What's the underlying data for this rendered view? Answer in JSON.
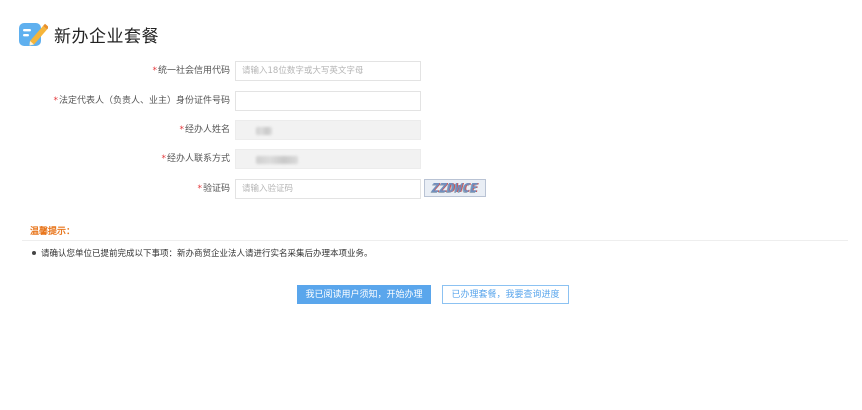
{
  "page": {
    "title": "新办企业套餐",
    "icon": "edit-document-icon",
    "accent_color": "#5aa6ec"
  },
  "form": {
    "required_mark": "*",
    "fields": [
      {
        "label": "统一社会信用代码",
        "placeholder": "请输入18位数字或大写英文字母",
        "value": ""
      },
      {
        "label": "法定代表人（负责人、业主）身份证件号码",
        "placeholder": "",
        "value": ""
      },
      {
        "label": "经办人姓名",
        "value": ""
      },
      {
        "label": "经办人联系方式",
        "value": ""
      },
      {
        "label": "验证码",
        "placeholder": "请输入验证码",
        "value": ""
      }
    ],
    "captcha_text": "ZZDWCE"
  },
  "tips": {
    "title": "温馨提示：",
    "items": [
      "请确认您单位已提前完成以下事项：新办商贸企业法人请进行实名采集后办理本项业务。"
    ]
  },
  "buttons": {
    "primary": "我已阅读用户须知，开始办理",
    "secondary": "已办理套餐，我要查询进度"
  }
}
